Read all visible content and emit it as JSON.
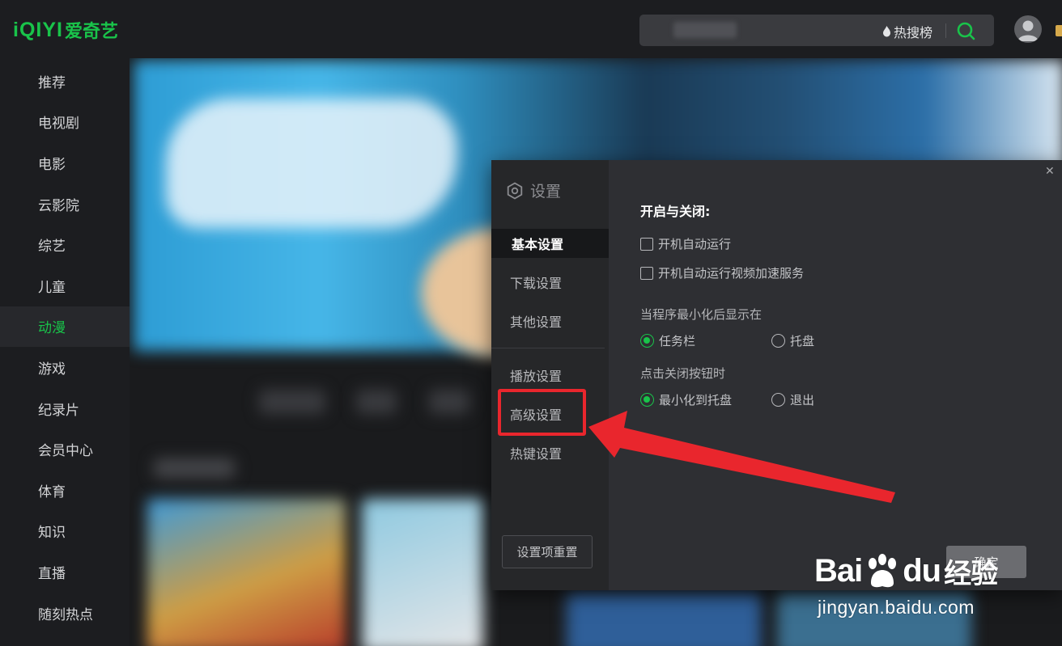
{
  "brand": {
    "logo_en": "iQIYI",
    "logo_cn": "爱奇艺",
    "color": "#19c34a"
  },
  "header": {
    "hot_label": "热搜榜",
    "search_icon": "search-icon"
  },
  "sidebar": {
    "items": [
      {
        "label": "推荐"
      },
      {
        "label": "电视剧"
      },
      {
        "label": "电影"
      },
      {
        "label": "云影院"
      },
      {
        "label": "综艺"
      },
      {
        "label": "儿童"
      },
      {
        "label": "动漫",
        "active": true
      },
      {
        "label": "游戏"
      },
      {
        "label": "纪录片"
      },
      {
        "label": "会员中心"
      },
      {
        "label": "体育"
      },
      {
        "label": "知识"
      },
      {
        "label": "直播"
      },
      {
        "label": "随刻热点"
      }
    ]
  },
  "settings": {
    "title": "设置",
    "menu": [
      {
        "label": "基本设置",
        "selected": true
      },
      {
        "label": "下载设置"
      },
      {
        "label": "其他设置"
      },
      {
        "label": "播放设置"
      },
      {
        "label": "高级设置",
        "highlighted": true
      },
      {
        "label": "热键设置"
      }
    ],
    "reset_label": "设置项重置",
    "section_title": "开启与关闭:",
    "checkboxes": [
      {
        "label": "开机自动运行",
        "checked": false
      },
      {
        "label": "开机自动运行视频加速服务",
        "checked": false
      }
    ],
    "minimize_group": {
      "label": "当程序最小化后显示在",
      "options": [
        {
          "label": "任务栏",
          "selected": true
        },
        {
          "label": "托盘",
          "selected": false
        }
      ]
    },
    "close_group": {
      "label": "点击关闭按钮时",
      "options": [
        {
          "label": "最小化到托盘",
          "selected": true
        },
        {
          "label": "退出",
          "selected": false
        }
      ]
    },
    "ok_label": "确定"
  },
  "annotation": {
    "color": "#e9262d"
  },
  "watermark": {
    "brand_a": "Bai",
    "brand_b": "du",
    "brand_cn": "经验",
    "url": "jingyan.baidu.com"
  }
}
